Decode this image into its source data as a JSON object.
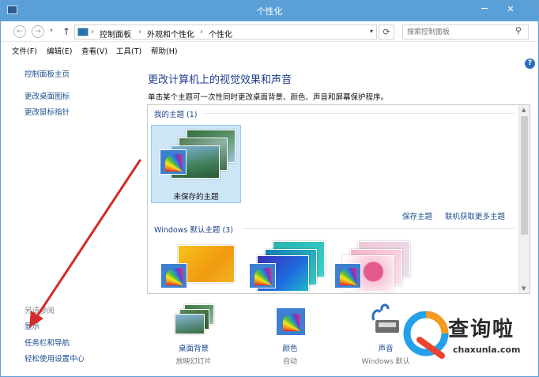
{
  "window": {
    "title": "个性化",
    "minimize": "─",
    "close": "✕"
  },
  "nav": {
    "back": "←",
    "forward": "→",
    "recent": "▾",
    "up": "↑",
    "refresh": "⟳",
    "breadcrumb": [
      "控制面板",
      "外观和个性化",
      "个性化"
    ],
    "separator": "›",
    "dropdown": "▾",
    "search_placeholder": "搜索控制面板",
    "search_icon": "⚲"
  },
  "menubar": [
    "文件(F)",
    "编辑(E)",
    "查看(V)",
    "工具(T)",
    "帮助(H)"
  ],
  "sidebar": {
    "links": [
      "控制面板主页",
      "更改桌面图标",
      "更改鼠标指针"
    ],
    "see_also_header": "另请参阅",
    "see_also": [
      "显示",
      "任务栏和导航",
      "轻松使用设置中心"
    ]
  },
  "main": {
    "heading": "更改计算机上的视觉效果和声音",
    "description": "单击某个主题可一次性同时更改桌面背景、颜色、声音和屏幕保护程序。",
    "help": "?"
  },
  "themes": {
    "my_group": "我的主题 (1)",
    "unsaved_label": "未保存的主题",
    "save_link": "保存主题",
    "online_link": "联机获取更多主题",
    "default_group": "Windows 默认主题 (3)",
    "scroll_up": "▲",
    "scroll_down": "▼"
  },
  "bottom": {
    "items": [
      {
        "label": "桌面背景",
        "sub": "放映幻灯片"
      },
      {
        "label": "颜色",
        "sub": "自动"
      },
      {
        "label": "声音",
        "sub": "Windows 默认"
      }
    ]
  },
  "watermark": {
    "brand": "查询啦",
    "site": "chaxunla.com"
  },
  "colors": {
    "titlebar": "#5aa0d8",
    "link": "#1a4b8c",
    "heading": "#1e3f8c",
    "selected": "#cde6f7",
    "arrow": "#d42a2a"
  }
}
